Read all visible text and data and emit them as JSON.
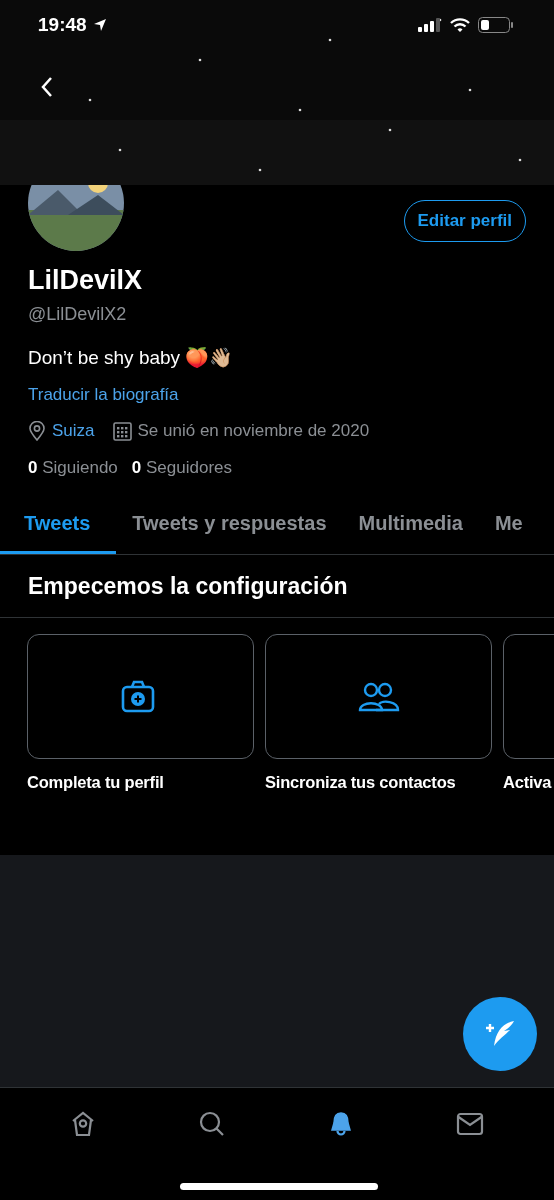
{
  "status_bar": {
    "time": "19:48"
  },
  "profile": {
    "name": "LilDevilX",
    "handle": "@LilDevilX2",
    "bio": "Don’t be shy baby 🍑👋🏼",
    "translate_link": "Traducir la biografía",
    "location": "Suiza",
    "joined": "Se unió en noviembre de 2020",
    "following_count": "0",
    "following_label": "Siguiendo",
    "followers_count": "0",
    "followers_label": "Seguidores",
    "edit_button": "Editar perfil"
  },
  "tabs": [
    {
      "label": "Tweets",
      "selected": true
    },
    {
      "label": "Tweets y respuestas",
      "selected": false
    },
    {
      "label": "Multimedia",
      "selected": false
    },
    {
      "label": "Me",
      "selected": false
    }
  ],
  "setup": {
    "title": "Empecemos la configuración",
    "cards": [
      {
        "kind": "camera",
        "label": "Completa tu perfil"
      },
      {
        "kind": "people",
        "label": "Sincroniza tus contactos"
      },
      {
        "kind": "none",
        "label": "Activa"
      }
    ]
  },
  "bottom_nav": [
    {
      "kind": "home",
      "selected": false
    },
    {
      "kind": "search",
      "selected": false
    },
    {
      "kind": "bell",
      "selected": true
    },
    {
      "kind": "mail",
      "selected": false
    }
  ]
}
